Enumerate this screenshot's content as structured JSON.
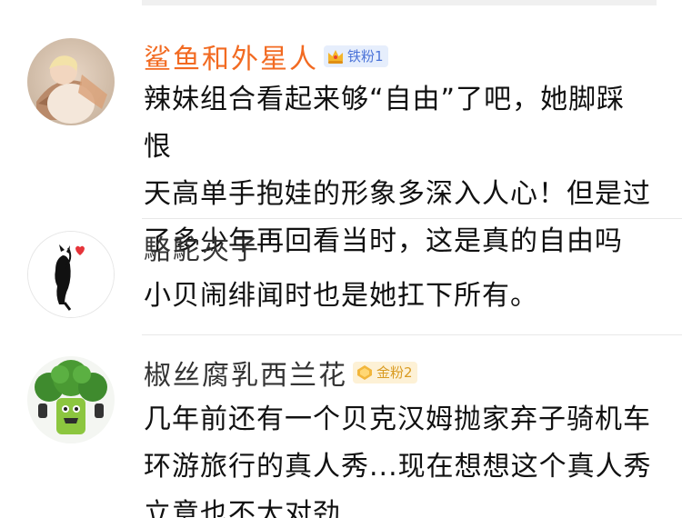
{
  "comments": [
    {
      "username": "鲨鱼和外星人",
      "username_color": "#f26a21",
      "avatar_icon": "user-avatar-photo",
      "badge": {
        "icon": "crown-icon",
        "label": "铁粉1",
        "color": "#4b73d8"
      },
      "text": "辣妹组合看起来够“自由”了吧，她脚踩恨\n天高单手抱娃的形象多深入人心！但是过\n了多少年再回看当时，这是真的自由吗"
    },
    {
      "username": "駱駝夾子",
      "username_color": "#333333",
      "avatar_icon": "black-cat-avatar",
      "text": "小贝闹绯闻时也是她扛下所有。"
    },
    {
      "username": "椒丝腐乳西兰花",
      "username_color": "#333333",
      "avatar_icon": "broccoli-avatar",
      "badge": {
        "icon": "diamond-icon",
        "label": "金粉2",
        "color": "#d99b22"
      },
      "text": "几年前还有一个贝克汉姆抛家弃子骑机车\n环游旅行的真人秀...现在想想这个真人秀\n立意也不太对劲..."
    }
  ]
}
